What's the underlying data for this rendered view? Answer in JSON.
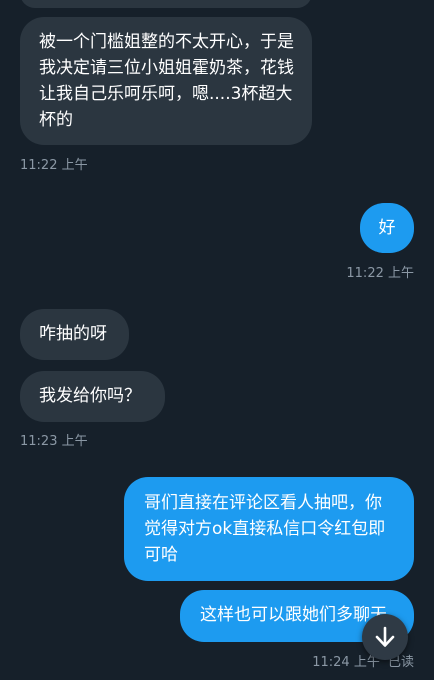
{
  "messages": [
    {
      "text": "被一个门槛姐整的不太开心，于是我决定请三位小姐姐霍奶茶，花钱让我自己乐呵乐呵，嗯....3杯超大杯的",
      "time": "11:22 上午"
    },
    {
      "text": "好",
      "time": "11:22 上午"
    },
    {
      "text": "咋抽的呀"
    },
    {
      "text": "我发给你吗？",
      "time": "11:23 上午"
    },
    {
      "text": "哥们直接在评论区看人抽吧，你觉得对方ok直接私信口令红包即可哈"
    },
    {
      "text": "这样也可以跟她们多聊天",
      "time": "11:24 上午",
      "status": "已读"
    }
  ],
  "icons": {
    "scroll_down": "arrow-down-icon"
  },
  "colors": {
    "background": "#16202a",
    "incoming": "#2b3640",
    "outgoing": "#1d9bf0",
    "meta": "#8b98a5"
  }
}
